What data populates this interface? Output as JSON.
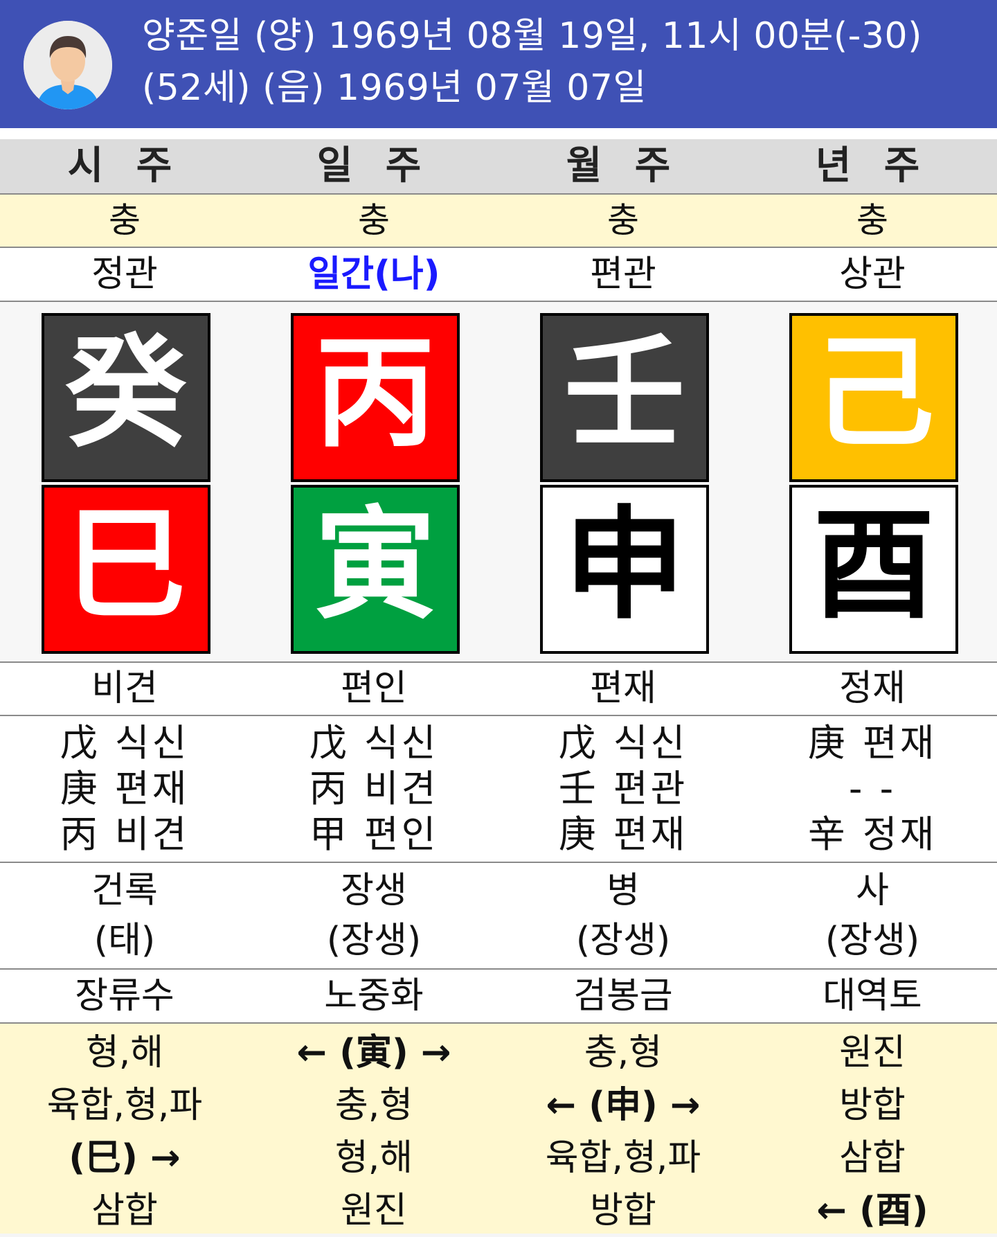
{
  "header": {
    "line1": "양준일 (양) 1969년 08월 19일, 11시 00분(-30)",
    "line2": "(52세) (음) 1969년 07월 07일"
  },
  "columns": [
    "시 주",
    "일 주",
    "월 주",
    "년 주"
  ],
  "row_yellow": [
    "충",
    "충",
    "충",
    "충"
  ],
  "row_sipsung": [
    "정관",
    "일간(나)",
    "편관",
    "상관"
  ],
  "heavenly_stems": [
    {
      "char": "癸",
      "bg": "#3f3f3f",
      "fg": "#ffffff"
    },
    {
      "char": "丙",
      "bg": "#ff0000",
      "fg": "#ffffff"
    },
    {
      "char": "壬",
      "bg": "#3f3f3f",
      "fg": "#ffffff"
    },
    {
      "char": "己",
      "bg": "#ffc000",
      "fg": "#ffffff"
    }
  ],
  "earthly_branches": [
    {
      "char": "巳",
      "bg": "#ff0000",
      "fg": "#ffffff"
    },
    {
      "char": "寅",
      "bg": "#00a040",
      "fg": "#ffffff"
    },
    {
      "char": "申",
      "bg": "#ffffff",
      "fg": "#000000"
    },
    {
      "char": "酉",
      "bg": "#ffffff",
      "fg": "#000000"
    }
  ],
  "row_ten_gods": [
    "비견",
    "편인",
    "편재",
    "정재"
  ],
  "hidden_stems": [
    [
      "戊 식신",
      "庚 편재",
      "丙 비견"
    ],
    [
      "戊 식신",
      "丙 비견",
      "甲 편인"
    ],
    [
      "戊 식신",
      "壬 편관",
      "庚 편재"
    ],
    [
      "庚 편재",
      "- -",
      "辛 정재"
    ]
  ],
  "twelve_stages": [
    [
      "건록",
      "(태)"
    ],
    [
      "장생",
      "(장생)"
    ],
    [
      "병",
      "(장생)"
    ],
    [
      "사",
      "(장생)"
    ]
  ],
  "napeum": [
    "장류수",
    "노중화",
    "검봉금",
    "대역토"
  ],
  "relations": [
    [
      "형,해",
      "육합,형,파",
      "(巳) →",
      "삼합"
    ],
    [
      "← (寅) →",
      "충,형",
      "형,해",
      "원진"
    ],
    [
      "충,형",
      "← (申) →",
      "육합,형,파",
      "방합"
    ],
    [
      "원진",
      "방합",
      "삼합",
      "← (酉)"
    ]
  ]
}
